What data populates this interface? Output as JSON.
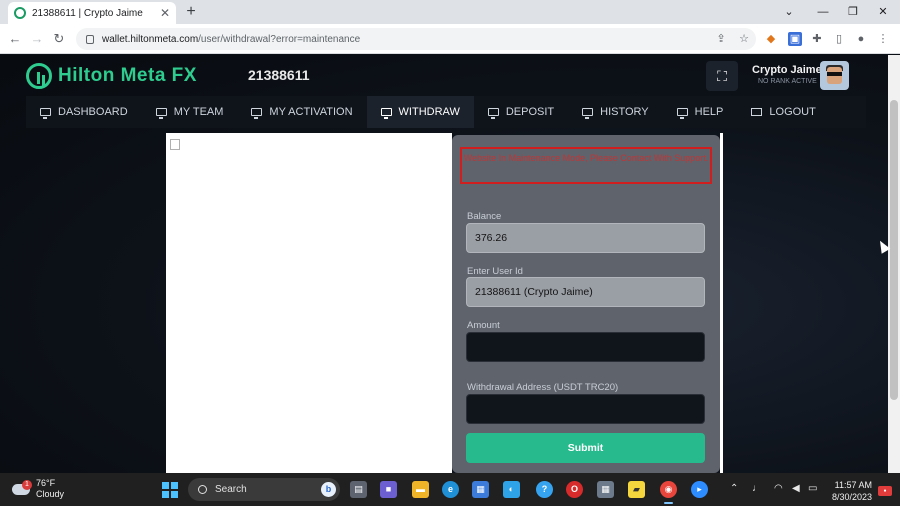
{
  "browser": {
    "tab_title": "21388611 | Crypto Jaime",
    "tab_close": "✕",
    "new_tab": "+",
    "url_host": "wallet.hiltonmeta.com",
    "url_path": "/user/withdrawal?error=maintenance",
    "window_controls": [
      "⌄",
      "—",
      "❐",
      "✕"
    ]
  },
  "header": {
    "logo_text": "Hilton Meta FX",
    "user_id": "21388611",
    "user_name": "Crypto Jaime",
    "user_rank": "NO RANK ACTIVE"
  },
  "nav": {
    "items": [
      {
        "label": "DASHBOARD",
        "icon": "monitor-icon"
      },
      {
        "label": "MY TEAM",
        "icon": "monitor-icon"
      },
      {
        "label": "MY ACTIVATION",
        "icon": "monitor-icon"
      },
      {
        "label": "WITHDRAW",
        "icon": "monitor-icon",
        "active": true
      },
      {
        "label": "DEPOSIT",
        "icon": "monitor-icon"
      },
      {
        "label": "HISTORY",
        "icon": "monitor-icon"
      },
      {
        "label": "HELP",
        "icon": "monitor-icon"
      },
      {
        "label": "LOGOUT",
        "icon": "envelope-icon"
      }
    ]
  },
  "withdraw_form": {
    "alert": "Website In Maintenance Mode, Please Contact With Support.",
    "balance_label": "Balance",
    "balance_value": "376.26",
    "user_id_label": "Enter User Id",
    "user_id_value": "21388611 (Crypto Jaime)",
    "amount_label": "Amount",
    "amount_value": "",
    "address_label": "Withdrawal Address (USDT TRC20)",
    "address_value": "",
    "submit_label": "Submit"
  },
  "taskbar": {
    "weather_badge": "1",
    "weather_temp": "76°F",
    "weather_desc": "Cloudy",
    "search_label": "Search",
    "time": "11:57 AM",
    "date": "8/30/2023"
  },
  "colors": {
    "brand_green": "#2ecc8f",
    "submit_green": "#26ba8c",
    "alert_red": "#d01d1d",
    "card_bg": "#5e636c"
  }
}
